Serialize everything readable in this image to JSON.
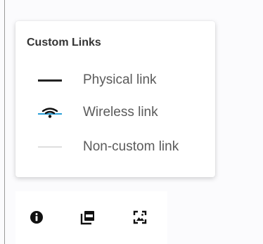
{
  "legend": {
    "title": "Custom Links",
    "items": [
      {
        "label": "Physical link",
        "icon": "solid-line-icon",
        "color": "#222222"
      },
      {
        "label": "Wireless link",
        "icon": "wifi-icon",
        "color": "#2a9fd8"
      },
      {
        "label": "Non-custom link",
        "icon": "faint-line-icon",
        "color": "#dedede"
      }
    ]
  },
  "toolbar": {
    "buttons": [
      {
        "icon": "info-icon"
      },
      {
        "icon": "pdf-export-icon"
      },
      {
        "icon": "image-export-icon"
      }
    ]
  }
}
